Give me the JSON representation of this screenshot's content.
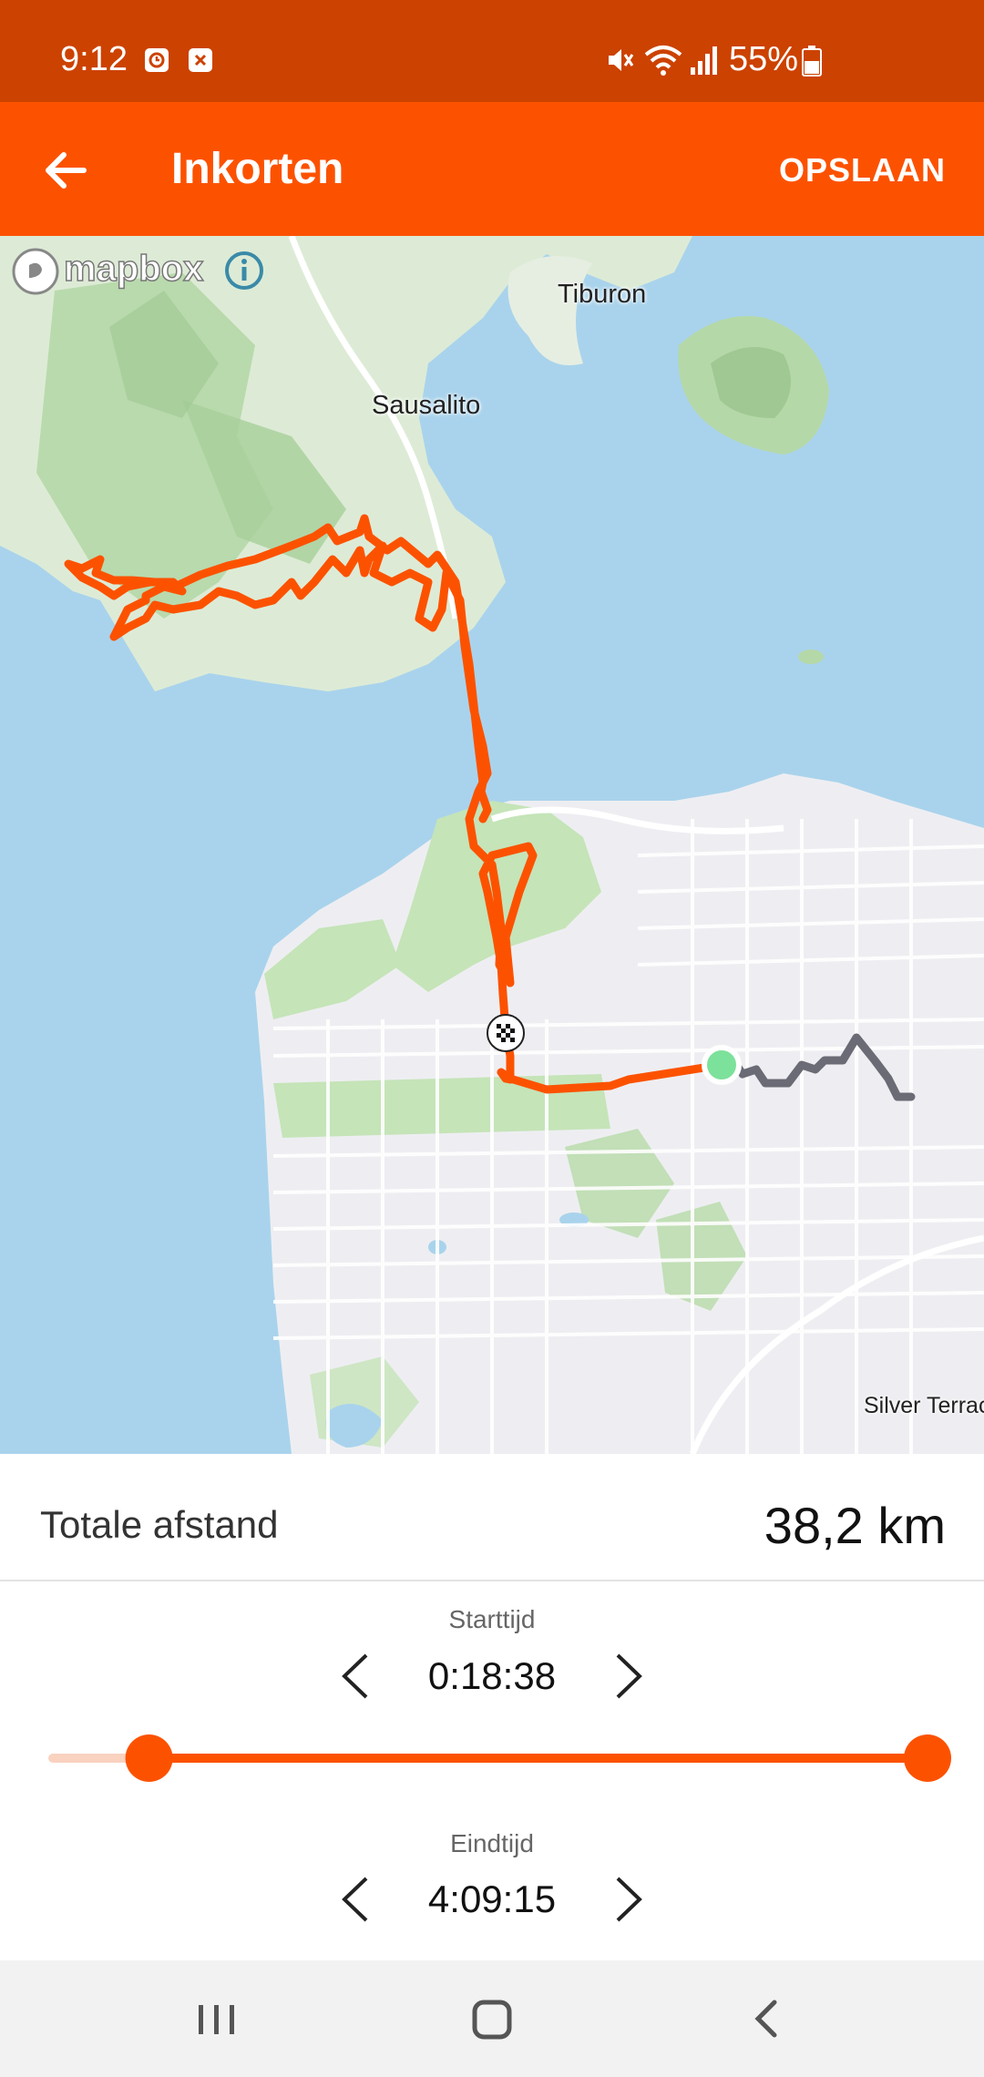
{
  "status": {
    "time": "9:12",
    "battery": "55%",
    "icons": [
      "alarm-icon",
      "no-sim-icon",
      "mute-icon",
      "wifi-icon",
      "signal-icon",
      "battery-icon"
    ]
  },
  "header": {
    "title": "Inkorten",
    "save_label": "OPSLAAN",
    "accent_color": "#FC5200"
  },
  "map": {
    "attribution": "mapbox",
    "places": [
      "Tiburon",
      "Sausalito",
      "Silver Terrac"
    ]
  },
  "summary": {
    "distance_label": "Totale afstand",
    "distance_value": "38,2 km"
  },
  "start": {
    "label": "Starttijd",
    "value": "0:18:38"
  },
  "end": {
    "label": "Eindtijd",
    "value": "4:09:15"
  },
  "trim_range": {
    "start_fraction": 0.11,
    "end_fraction": 1.0
  }
}
